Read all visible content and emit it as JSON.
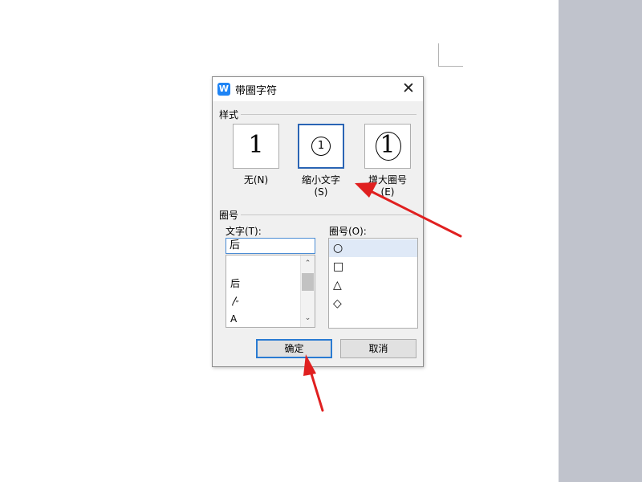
{
  "dialog": {
    "title": "带圈字符",
    "app_icon_letter": "W",
    "close_glyph": "✕"
  },
  "style_group": {
    "label": "样式",
    "options": [
      {
        "glyph": "1",
        "label_line1": "无(N)",
        "label_line2": "",
        "selected": false
      },
      {
        "glyph": "1",
        "label_line1": "缩小文字",
        "label_line2": "(S)",
        "selected": true
      },
      {
        "glyph": "1",
        "label_line1": "增大圈号",
        "label_line2": "(E)",
        "selected": false
      }
    ]
  },
  "circle_group": {
    "label": "圈号",
    "text_label": "文字(T):",
    "text_value": "后",
    "text_list": [
      "后",
      "〴",
      "A"
    ],
    "shape_label": "圈号(O):",
    "shapes": [
      "○",
      "□",
      "△",
      "◇"
    ],
    "selected_shape": 0
  },
  "scroll": {
    "up": "⌃",
    "down": "⌄"
  },
  "buttons": {
    "ok": "确定",
    "cancel": "取消"
  },
  "colors": {
    "accent": "#2a64b4",
    "arrow": "#e02020",
    "app_icon": "#1e84f5"
  }
}
